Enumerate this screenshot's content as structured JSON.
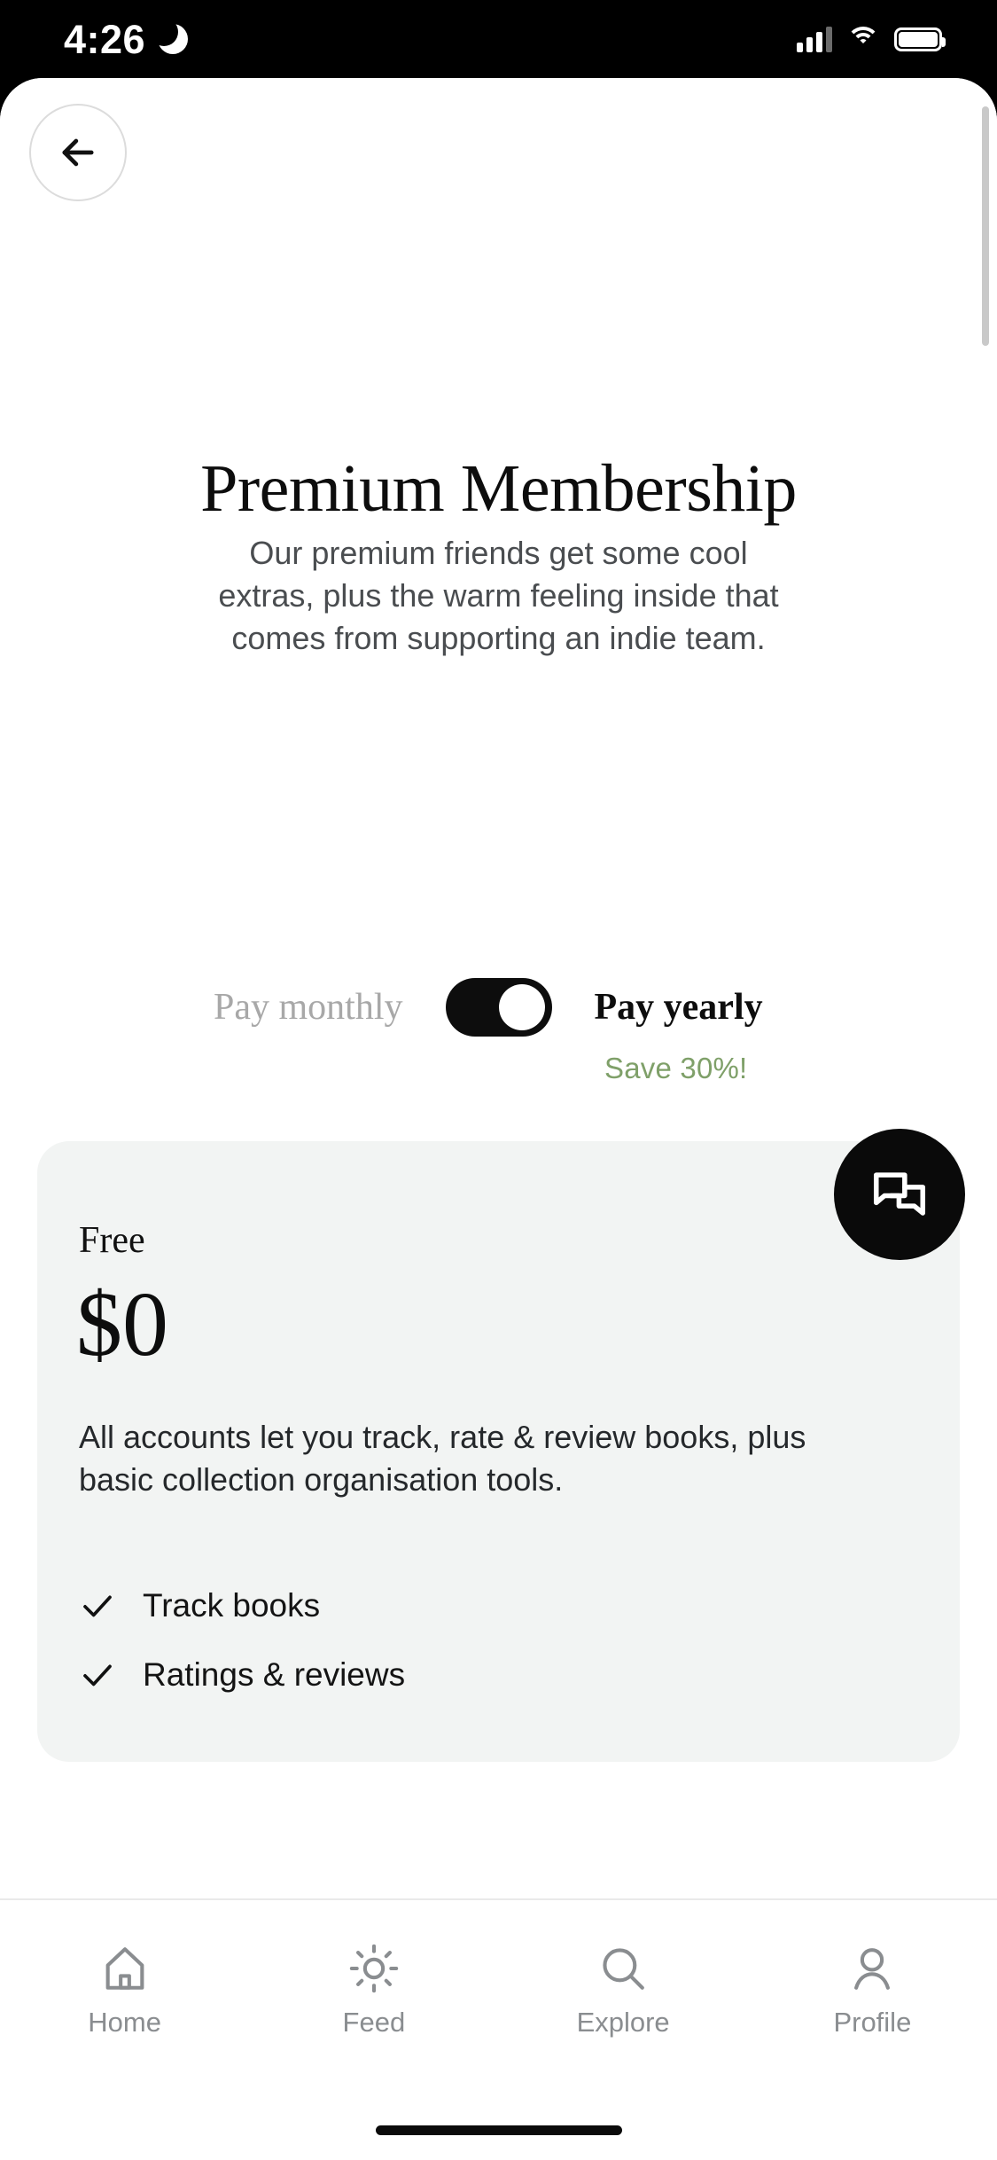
{
  "status_bar": {
    "time": "4:26",
    "dnd_icon": "crescent-moon-icon",
    "signal_icon": "cellular-signal-icon",
    "wifi_icon": "wifi-icon",
    "battery_icon": "battery-full-icon"
  },
  "header": {
    "back_icon": "arrow-left-icon",
    "title": "Premium Membership",
    "subtitle": "Our premium friends get some cool extras, plus the warm feeling inside that comes from supporting an indie team."
  },
  "billing_toggle": {
    "monthly_label": "Pay monthly",
    "yearly_label": "Pay yearly",
    "save_label": "Save 30%!",
    "selected": "yearly",
    "save_color": "#7fa069"
  },
  "plan_card": {
    "name": "Free",
    "price": "$0",
    "description": "All accounts let you track, rate & review books, plus basic collection organisation tools.",
    "features": [
      {
        "label": "Track books",
        "icon": "check-icon"
      },
      {
        "label": "Ratings & reviews",
        "icon": "check-icon"
      }
    ],
    "background_color": "#f2f4f3"
  },
  "chat_fab": {
    "icon": "chat-bubbles-icon",
    "background_color": "#0a0a0a"
  },
  "bottom_nav": {
    "items": [
      {
        "label": "Home",
        "icon": "home-icon"
      },
      {
        "label": "Feed",
        "icon": "sun-icon"
      },
      {
        "label": "Explore",
        "icon": "search-icon"
      },
      {
        "label": "Profile",
        "icon": "person-icon"
      }
    ]
  }
}
